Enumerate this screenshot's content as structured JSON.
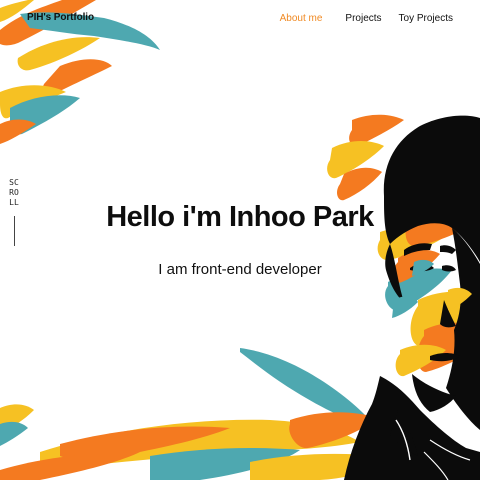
{
  "header": {
    "logo": "PIH's Portfolio",
    "nav": [
      {
        "label": "About me",
        "active": true
      },
      {
        "label": "Projects",
        "active": false
      },
      {
        "label": "Toy Projects",
        "active": false
      }
    ]
  },
  "scroll": {
    "label": "SCROLL"
  },
  "hero": {
    "title": "Hello i'm Inhoo Park",
    "subtitle": "I am front-end developer"
  },
  "colors": {
    "accent": "#f08a24",
    "orange": "#f47a20",
    "yellow": "#f6c123",
    "teal": "#4ea8b0",
    "portrait": "#0b0b0b"
  },
  "icons": {
    "scroll": "scroll-line-icon"
  }
}
